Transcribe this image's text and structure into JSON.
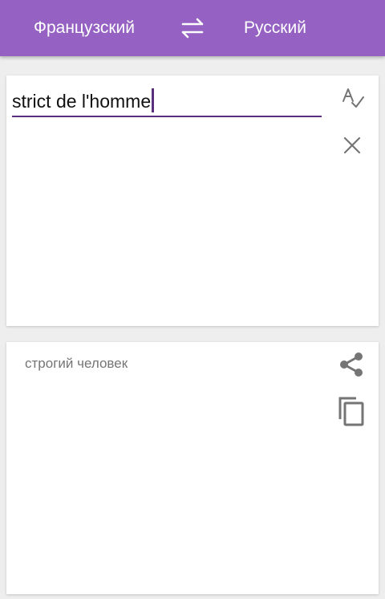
{
  "header": {
    "source_language": "Французский",
    "target_language": "Русский",
    "swap_icon": "swap-arrows-icon"
  },
  "input": {
    "text": "strict de l'homme",
    "spellcheck_icon": "spellcheck-icon",
    "clear_icon": "close-icon"
  },
  "output": {
    "translation": "строгий человек",
    "share_icon": "share-icon",
    "copy_icon": "copy-icon"
  },
  "colors": {
    "accent": "#9561c3",
    "underline": "#5a2f7d",
    "icon_gray": "#757575"
  }
}
